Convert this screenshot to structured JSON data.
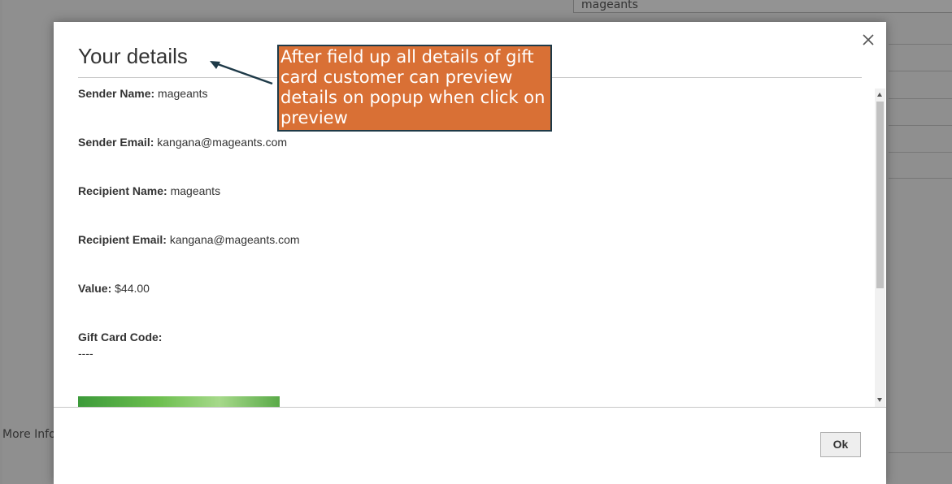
{
  "background": {
    "input_value": "mageants",
    "tab_label": "More Information"
  },
  "modal": {
    "title": "Your details",
    "close_label": "×",
    "rows": [
      {
        "label": "Sender Name:",
        "value": "mageants"
      },
      {
        "label": "Sender Email:",
        "value": "kangana@mageants.com"
      },
      {
        "label": "Recipient Name:",
        "value": "mageants"
      },
      {
        "label": "Recipient Email:",
        "value": "kangana@mageants.com"
      },
      {
        "label": "Value:",
        "value": "$44.00"
      },
      {
        "label": "Gift Card Code:",
        "value": "----"
      }
    ],
    "ok_label": "Ok"
  },
  "annotation": {
    "text": "After field up all details of gift card customer can preview details on popup when click on preview",
    "bg_color": "#d97035",
    "border_color": "#1e3a48"
  }
}
